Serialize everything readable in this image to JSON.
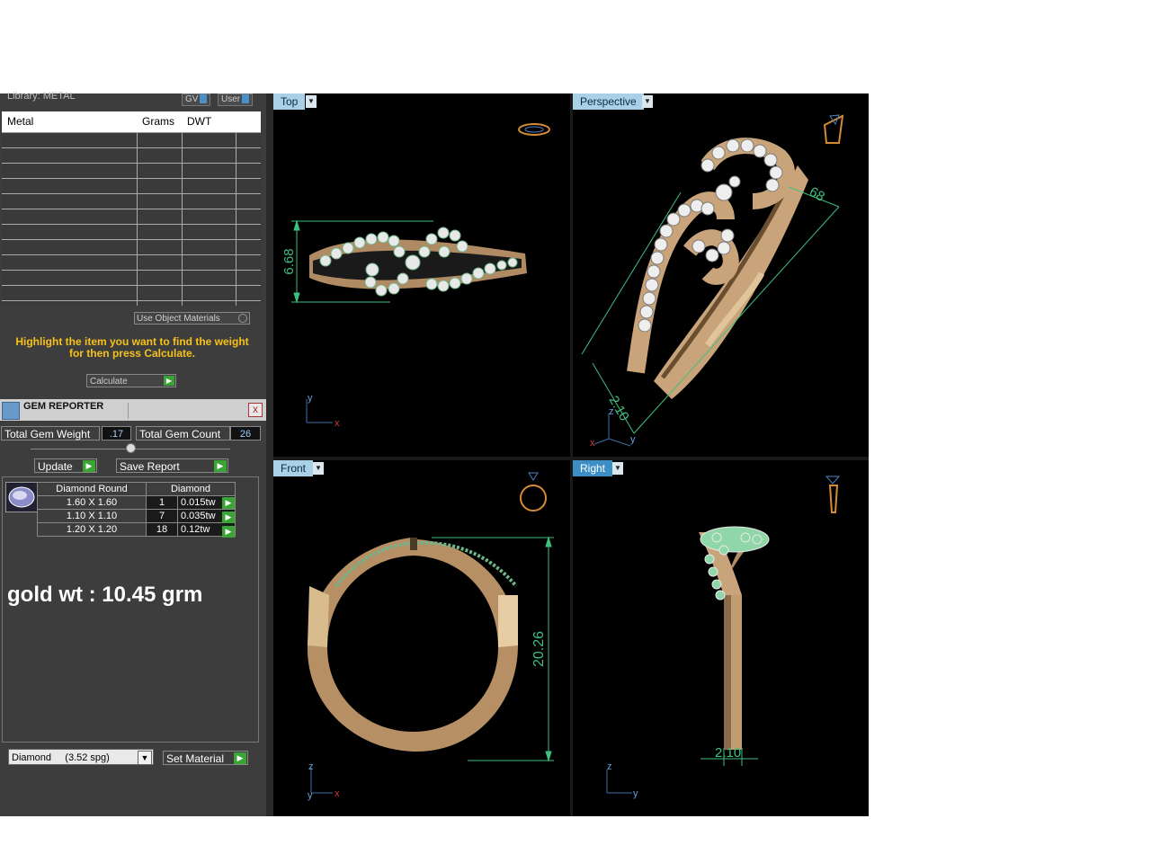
{
  "library": {
    "title": "Library: METAL",
    "gv_label": "GV",
    "user_label": "User"
  },
  "metal_table": {
    "columns": [
      "Metal",
      "Grams",
      "DWT"
    ],
    "rows": []
  },
  "use_object_materials": "Use Object Materials",
  "hint_line1": "Highlight the item you want to find the weight",
  "hint_line2": "for then press Calculate.",
  "calculate_label": "Calculate",
  "gem_reporter": {
    "title": "GEM REPORTER",
    "close": "x",
    "total_weight_label": "Total Gem Weight",
    "total_weight_value": ".17",
    "total_count_label": "Total Gem Count",
    "total_count_value": "26",
    "update_label": "Update",
    "save_report_label": "Save Report",
    "table_headers": [
      "Diamond Round",
      "Diamond"
    ],
    "rows": [
      {
        "size": "1.60 X 1.60",
        "count": "1",
        "weight": "0.015tw"
      },
      {
        "size": "1.10 X 1.10",
        "count": "7",
        "weight": "0.035tw"
      },
      {
        "size": "1.20 X 1.20",
        "count": "18",
        "weight": "0.12tw"
      }
    ]
  },
  "gold_weight": "gold wt : 10.45 grm",
  "material_select": "Diamond     (3.52 spg)",
  "set_material_label": "Set Material",
  "viewports": {
    "top": {
      "label": "Top",
      "dimension": "6.68",
      "axis_up": "y",
      "axis_right": "x"
    },
    "perspective": {
      "label": "Perspective",
      "dimension": "68",
      "dimension2": "2.10",
      "axis_up": "z",
      "axis_right": "y",
      "axis_third": "x"
    },
    "front": {
      "label": "Front",
      "dimension": "20.26",
      "axis_up": "z",
      "axis_right": "x",
      "axis_third": "y"
    },
    "right": {
      "label": "Right",
      "dimension": "2.10",
      "axis_up": "z",
      "axis_right": "y"
    }
  },
  "colors": {
    "gold": "#c9a47a",
    "gold_dark": "#8a6a48",
    "dimension": "#3fbf7f",
    "hint": "#f6c21a",
    "panel": "#3d3d3d"
  }
}
